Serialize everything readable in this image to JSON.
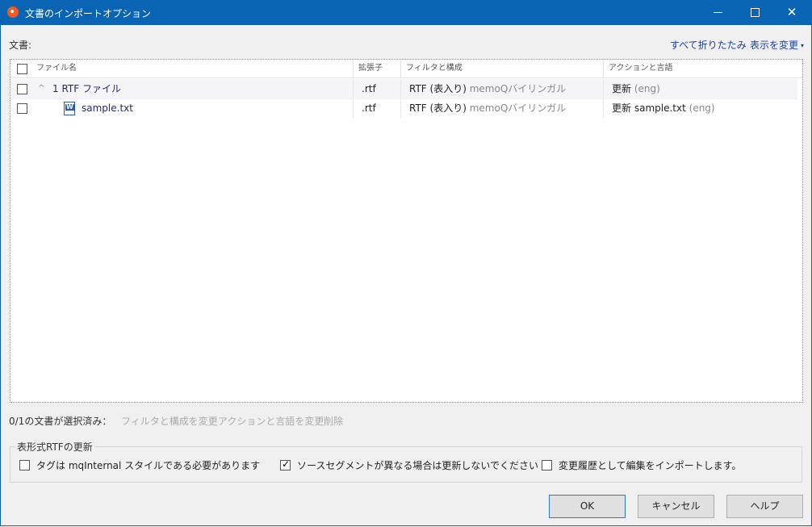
{
  "window": {
    "title": "文書のインポートオプション",
    "controls": {
      "minimize_icon": "minimize-icon",
      "maximize_icon": "maximize-icon",
      "close": "✕"
    }
  },
  "header": {
    "documents_label": "文書:",
    "collapse_all": "すべて折りたたみ",
    "change_view": "表示を変更",
    "change_view_caret": "▾"
  },
  "grid": {
    "columns": [
      "ファイル名",
      "拡張子",
      "フィルタと構成",
      "アクションと言語"
    ],
    "rows": [
      {
        "expander": "^",
        "name": "1 RTF ファイル",
        "ext": ".rtf",
        "filter": "RTF (表入り)",
        "filter_detail": "memoQバイリンガル",
        "action": "更新",
        "action_detail": "",
        "lang": "(eng)"
      },
      {
        "icon": "word-document-icon",
        "name": "sample.txt",
        "ext": ".rtf",
        "filter": "RTF (表入り)",
        "filter_detail": "memoQバイリンガル",
        "action": "更新",
        "action_detail": "sample.txt",
        "lang": "(eng)"
      }
    ]
  },
  "selection": {
    "status": "0/1の文書が選択済み：",
    "actions": [
      "フィルタと構成を変更",
      "アクションと言語を変更",
      "削除"
    ]
  },
  "options": {
    "group_title": "表形式RTFの更新",
    "items": [
      {
        "label": "タグは mqInternal スタイルである必要があります",
        "checked": false
      },
      {
        "label": "ソースセグメントが異なる場合は更新しないでください",
        "checked": true,
        "mark": "✓"
      },
      {
        "label": "変更履歴として編集をインポートします。",
        "checked": false
      }
    ]
  },
  "buttons": {
    "ok": "OK",
    "cancel": "キャンセル",
    "help": "ヘルプ"
  },
  "colors": {
    "titlebar": "#0a64b4",
    "link": "#1a3fa8",
    "disabled": "#aaaaaa"
  }
}
